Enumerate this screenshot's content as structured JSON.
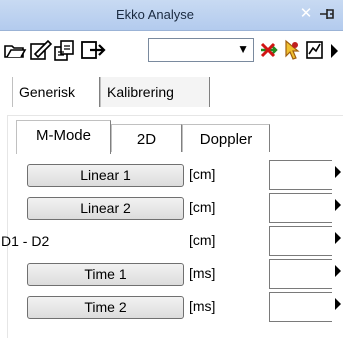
{
  "window": {
    "title": "Ekko Analyse"
  },
  "toolbar": {
    "icons": [
      "open-folder-icon",
      "edit-document-icon",
      "documents-icon",
      "export-icon",
      "delete-icon",
      "pointer-icon",
      "chart-icon"
    ],
    "combo_value": ""
  },
  "tabs_main": [
    {
      "label": "Generisk",
      "selected": true
    },
    {
      "label": "Kalibrering",
      "selected": false
    }
  ],
  "tabs_mode": [
    {
      "label": "M-Mode",
      "selected": true
    },
    {
      "label": "2D",
      "selected": false
    },
    {
      "label": "Doppler",
      "selected": false
    }
  ],
  "rows": [
    {
      "kind": "button",
      "label": "Linear 1",
      "unit": "[cm]",
      "value": ""
    },
    {
      "kind": "button",
      "label": "Linear 2",
      "unit": "[cm]",
      "value": ""
    },
    {
      "kind": "text",
      "label": "D1 - D2",
      "unit": "[cm]",
      "value": ""
    },
    {
      "kind": "button",
      "label": "Time 1",
      "unit": "[ms]",
      "value": ""
    },
    {
      "kind": "button",
      "label": "Time 2",
      "unit": "[ms]",
      "value": ""
    }
  ]
}
